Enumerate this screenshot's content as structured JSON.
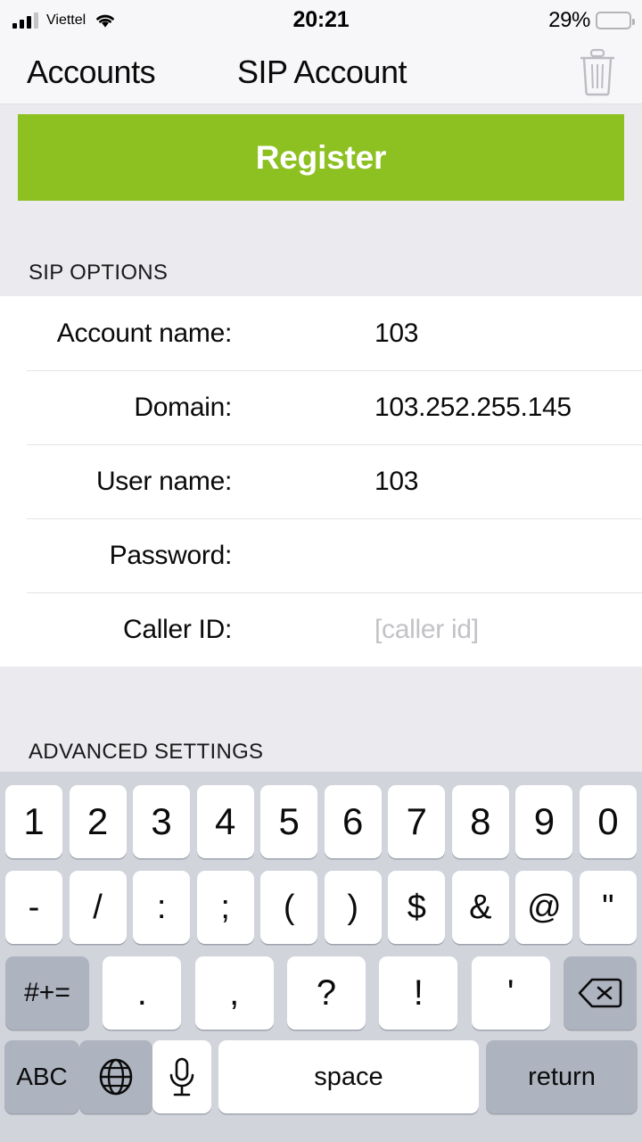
{
  "status_bar": {
    "carrier": "Viettel",
    "time": "20:21",
    "battery_percent": "29%",
    "battery_level": 29,
    "battery_color": "#FDC62E",
    "signal_icon": "cellular-signal-icon",
    "wifi_icon": "wifi-icon"
  },
  "nav": {
    "back_label": "Accounts",
    "title": "SIP Account",
    "delete_icon": "trash-icon"
  },
  "register": {
    "label": "Register",
    "color": "#8DC021"
  },
  "sections": {
    "sip_options_header": "SIP OPTIONS",
    "advanced_settings_header": "ADVANCED SETTINGS"
  },
  "form": {
    "rows": [
      {
        "label": "Account name:",
        "value": "103",
        "placeholder": ""
      },
      {
        "label": "Domain:",
        "value": "103.252.255.145",
        "placeholder": ""
      },
      {
        "label": "User name:",
        "value": "103",
        "placeholder": ""
      },
      {
        "label": "Password:",
        "value": "",
        "placeholder": ""
      },
      {
        "label": "Caller ID:",
        "value": "",
        "placeholder": "[caller id]"
      }
    ]
  },
  "keyboard": {
    "row1": [
      "1",
      "2",
      "3",
      "4",
      "5",
      "6",
      "7",
      "8",
      "9",
      "0"
    ],
    "row2": [
      "-",
      "/",
      ":",
      ";",
      "(",
      ")",
      "$",
      "&",
      "@",
      "\""
    ],
    "row3": {
      "symbols_key": "#+=",
      "keys": [
        ".",
        ",",
        "?",
        "!",
        "'"
      ],
      "backspace_icon": "backspace-icon"
    },
    "row4": {
      "abc": "ABC",
      "globe_icon": "globe-icon",
      "mic_icon": "microphone-icon",
      "space": "space",
      "return": "return"
    }
  }
}
